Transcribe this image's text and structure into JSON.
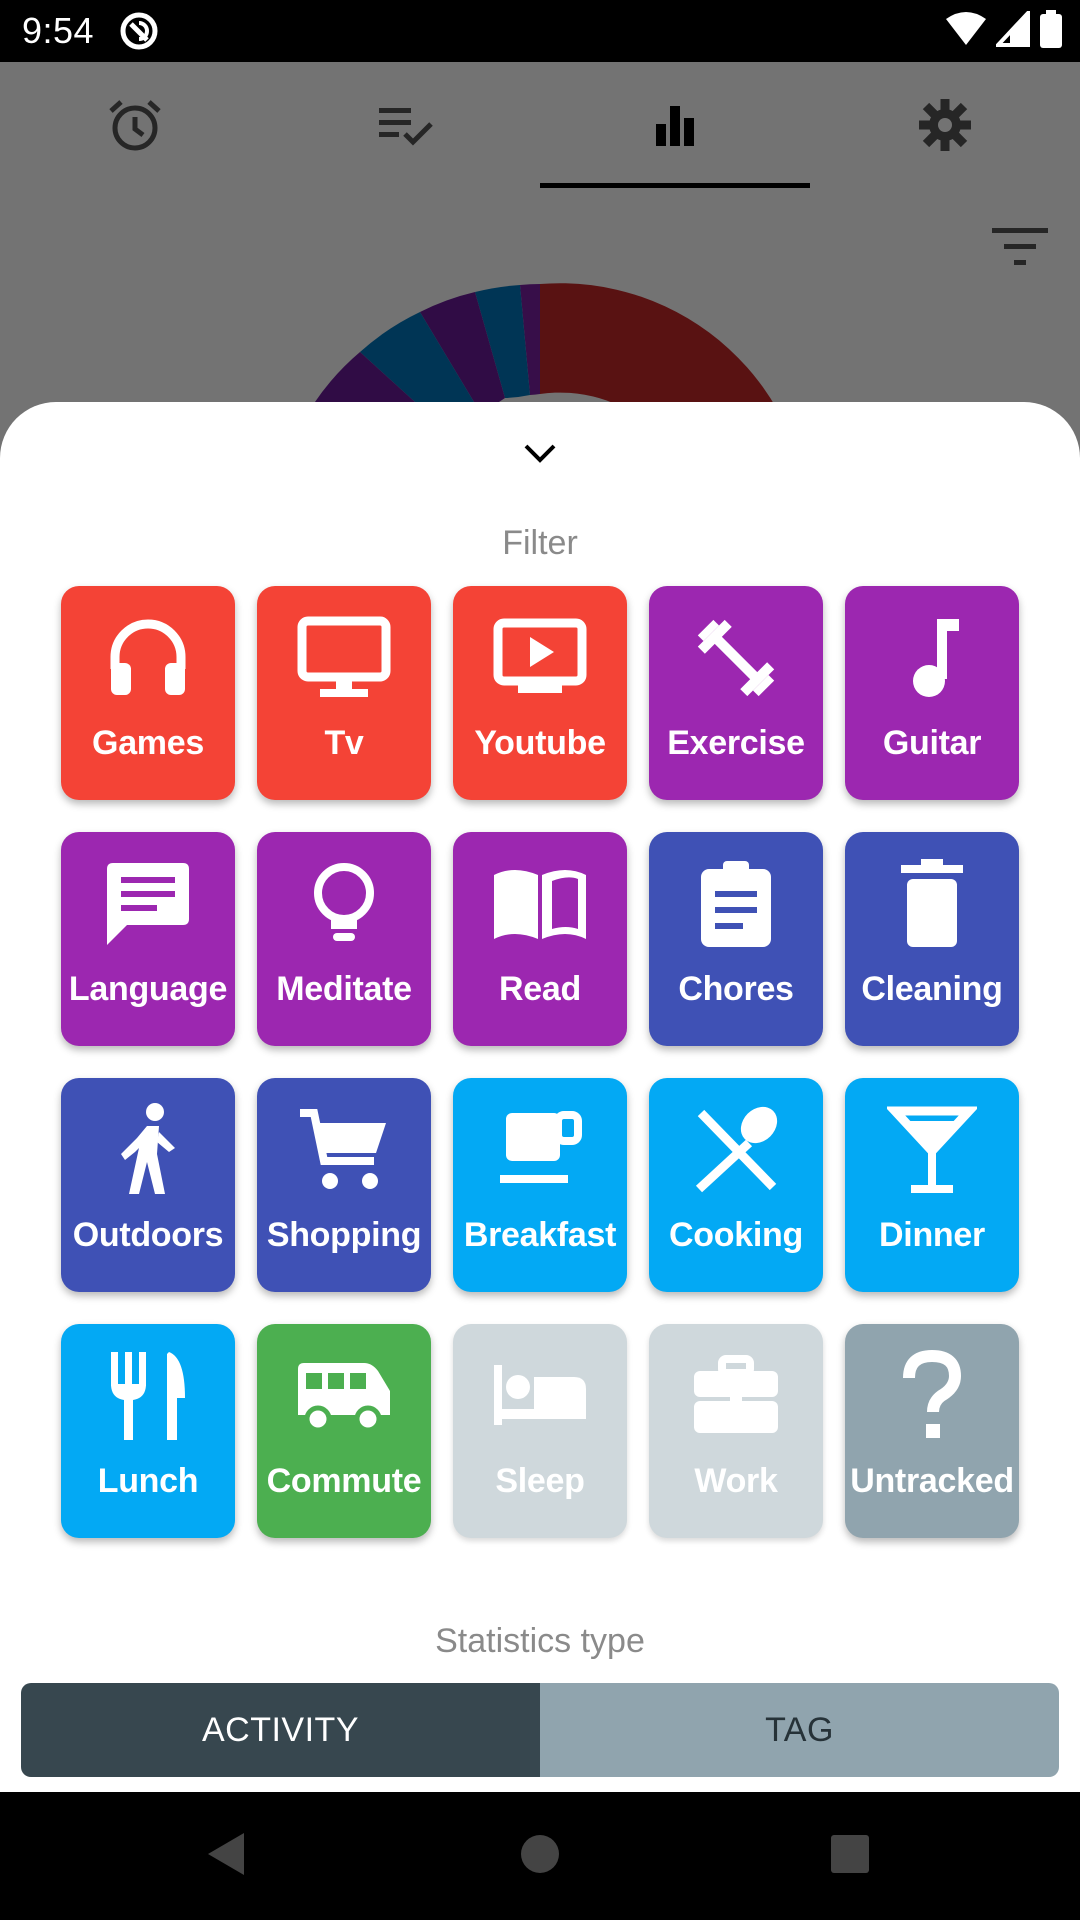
{
  "status_bar": {
    "time": "9:54",
    "icons": [
      "app-notification-icon",
      "wifi-icon",
      "cellular-signal-icon",
      "battery-icon"
    ]
  },
  "app_tabs": {
    "icons": [
      "alarm-clock-icon",
      "checklist-icon",
      "bar-chart-icon",
      "gear-icon"
    ],
    "selected_index": 2
  },
  "sheet": {
    "filter_title": "Filter",
    "stats_title": "Statistics type",
    "activities": [
      {
        "label": "Games",
        "icon": "headphones-icon",
        "color": "#F44336",
        "enabled": true
      },
      {
        "label": "Tv",
        "icon": "monitor-icon",
        "color": "#F44336",
        "enabled": true
      },
      {
        "label": "Youtube",
        "icon": "video-play-icon",
        "color": "#F44336",
        "enabled": true
      },
      {
        "label": "Exercise",
        "icon": "dumbbell-icon",
        "color": "#9C27B0",
        "enabled": true
      },
      {
        "label": "Guitar",
        "icon": "music-note-icon",
        "color": "#9C27B0",
        "enabled": true
      },
      {
        "label": "Language",
        "icon": "chat-bubble-icon",
        "color": "#9C27B0",
        "enabled": true
      },
      {
        "label": "Meditate",
        "icon": "lightbulb-icon",
        "color": "#9C27B0",
        "enabled": true
      },
      {
        "label": "Read",
        "icon": "open-book-icon",
        "color": "#9C27B0",
        "enabled": true
      },
      {
        "label": "Chores",
        "icon": "clipboard-icon",
        "color": "#3F51B5",
        "enabled": true
      },
      {
        "label": "Cleaning",
        "icon": "trash-bin-icon",
        "color": "#3F51B5",
        "enabled": true
      },
      {
        "label": "Outdoors",
        "icon": "walking-person-icon",
        "color": "#3F51B5",
        "enabled": true
      },
      {
        "label": "Shopping",
        "icon": "shopping-cart-icon",
        "color": "#3F51B5",
        "enabled": true
      },
      {
        "label": "Breakfast",
        "icon": "coffee-cup-icon",
        "color": "#03A9F4",
        "enabled": true
      },
      {
        "label": "Cooking",
        "icon": "utensils-cross-icon",
        "color": "#03A9F4",
        "enabled": true
      },
      {
        "label": "Dinner",
        "icon": "cocktail-glass-icon",
        "color": "#03A9F4",
        "enabled": true
      },
      {
        "label": "Lunch",
        "icon": "fork-knife-icon",
        "color": "#03A9F4",
        "enabled": true
      },
      {
        "label": "Commute",
        "icon": "bus-icon",
        "color": "#4CAF50",
        "enabled": true
      },
      {
        "label": "Sleep",
        "icon": "bed-icon",
        "color": "#CFD8DC",
        "enabled": false
      },
      {
        "label": "Work",
        "icon": "briefcase-icon",
        "color": "#CFD8DC",
        "enabled": false
      },
      {
        "label": "Untracked",
        "icon": "question-mark-icon",
        "color": "#90A4AE",
        "enabled": true
      }
    ],
    "toggle": {
      "activity_label": "ACTIVITY",
      "tag_label": "TAG",
      "selected": "ACTIVITY",
      "selected_color": "#37474F",
      "unselected_color": "#90A4AE"
    }
  },
  "nav_bar": {
    "icons": [
      "back-triangle-icon",
      "home-circle-icon",
      "recents-square-icon"
    ]
  }
}
